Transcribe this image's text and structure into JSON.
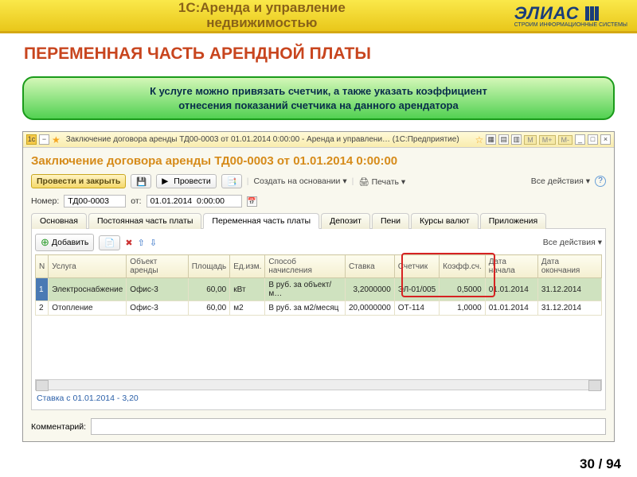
{
  "banner": {
    "title_l1": "1С:Аренда и управление",
    "title_l2": "недвижимостью",
    "logo": "ЭЛИАС",
    "logo_sub": "СТРОИМ ИНФОРМАЦИОННЫЕ СИСТЕМЫ"
  },
  "slide_title": "ПЕРЕМЕННАЯ ЧАСТЬ АРЕНДНОЙ ПЛАТЫ",
  "note_l1": "К услуге можно привязать счетчик, а также указать коэффициент",
  "note_l2": "отнесения показаний счетчика на данного арендатора",
  "window": {
    "title": "Заключение договора аренды ТД00-0003 от 01.01.2014 0:00:00 - Аренда и управлени…  (1С:Предприятие)",
    "doc_title": "Заключение договора аренды ТД00-0003 от 01.01.2014 0:00:00",
    "toolbar": {
      "run_close": "Провести и закрыть",
      "run": "Провести",
      "create": "Создать на основании",
      "print": "Печать",
      "all_actions": "Все действия"
    },
    "fields": {
      "num_label": "Номер:",
      "num_value": "ТД00-0003",
      "date_label": "от:",
      "date_value": "01.01.2014  0:00:00"
    },
    "tabs": [
      "Основная",
      "Постоянная часть платы",
      "Переменная часть платы",
      "Депозит",
      "Пени",
      "Курсы валют",
      "Приложения"
    ],
    "panel_tb": {
      "add": "Добавить",
      "all": "Все действия"
    },
    "grid": {
      "headers": [
        "N",
        "Услуга",
        "Объект аренды",
        "Площадь",
        "Ед.изм.",
        "Способ начисления",
        "Ставка",
        "Счетчик",
        "Коэфф.сч.",
        "Дата начала",
        "Дата окончания"
      ],
      "rows": [
        {
          "n": "1",
          "service": "Электроснабжение",
          "obj": "Офис-3",
          "area": "60,00",
          "ed": "кВт",
          "method": "В руб. за объект/м…",
          "rate": "3,2000000",
          "meter": "ЭЛ-01/005",
          "coef": "0,5000",
          "d1": "01.01.2014",
          "d2": "31.12.2014"
        },
        {
          "n": "2",
          "service": "Отопление",
          "obj": "Офис-3",
          "area": "60,00",
          "ed": "м2",
          "method": "В руб. за м2/месяц",
          "rate": "20,0000000",
          "meter": "ОТ-114",
          "coef": "1,0000",
          "d1": "01.01.2014",
          "d2": "31.12.2014"
        }
      ]
    },
    "stavka": "Ставка  с 01.01.2014 - 3,20",
    "comment_label": "Комментарий:"
  },
  "pager": "30 / 94"
}
